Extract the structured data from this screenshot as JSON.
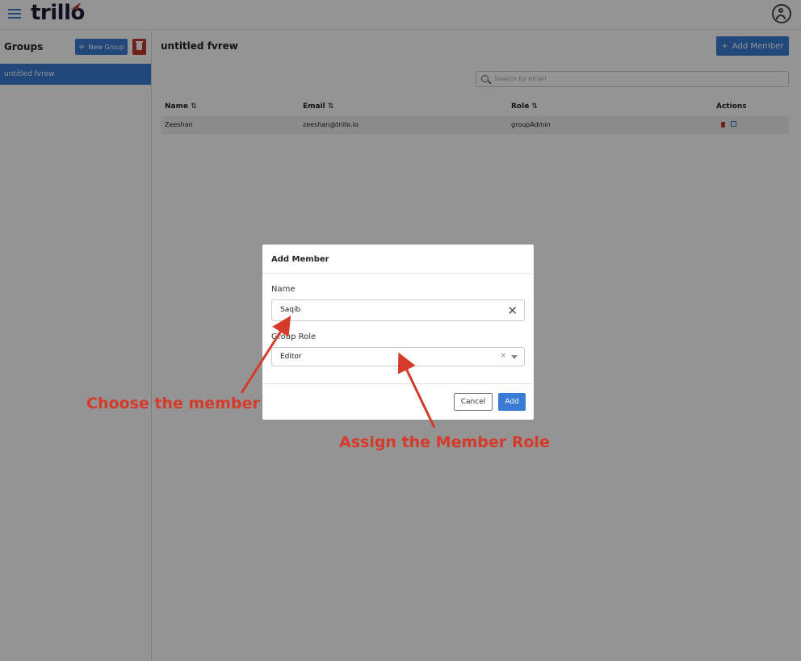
{
  "header": {
    "logo_text": "trillo",
    "menu_icon": "hamburger-icon",
    "profile_icon": "user-circle-icon"
  },
  "sidebar": {
    "title": "Groups",
    "new_group_label": "New Group",
    "groups": [
      {
        "label": "untitled fvrew",
        "selected": true
      }
    ]
  },
  "main": {
    "title": "untitled fvrew",
    "add_member_label": "Add Member",
    "search_placeholder": "Search by email",
    "table": {
      "columns": [
        {
          "label": "Name",
          "sortable": true
        },
        {
          "label": "Email",
          "sortable": true
        },
        {
          "label": "Role",
          "sortable": true
        },
        {
          "label": "Actions",
          "sortable": false
        }
      ],
      "rows": [
        {
          "name": "Zeeshan",
          "email": "zeeshan@trillo.io",
          "role": "groupAdmin"
        }
      ]
    }
  },
  "modal": {
    "title": "Add Member",
    "name_label": "Name",
    "name_value": "Saqib",
    "role_label": "Group Role",
    "role_value": "Editor",
    "cancel_label": "Cancel",
    "add_label": "Add"
  },
  "annotations": {
    "choose_member": "Choose the member",
    "assign_role": "Assign the Member Role"
  },
  "colors": {
    "accent": "#3a7bd5",
    "danger": "#c0392b",
    "annotation": "#d63a2a"
  },
  "sort_icon": "⇅"
}
